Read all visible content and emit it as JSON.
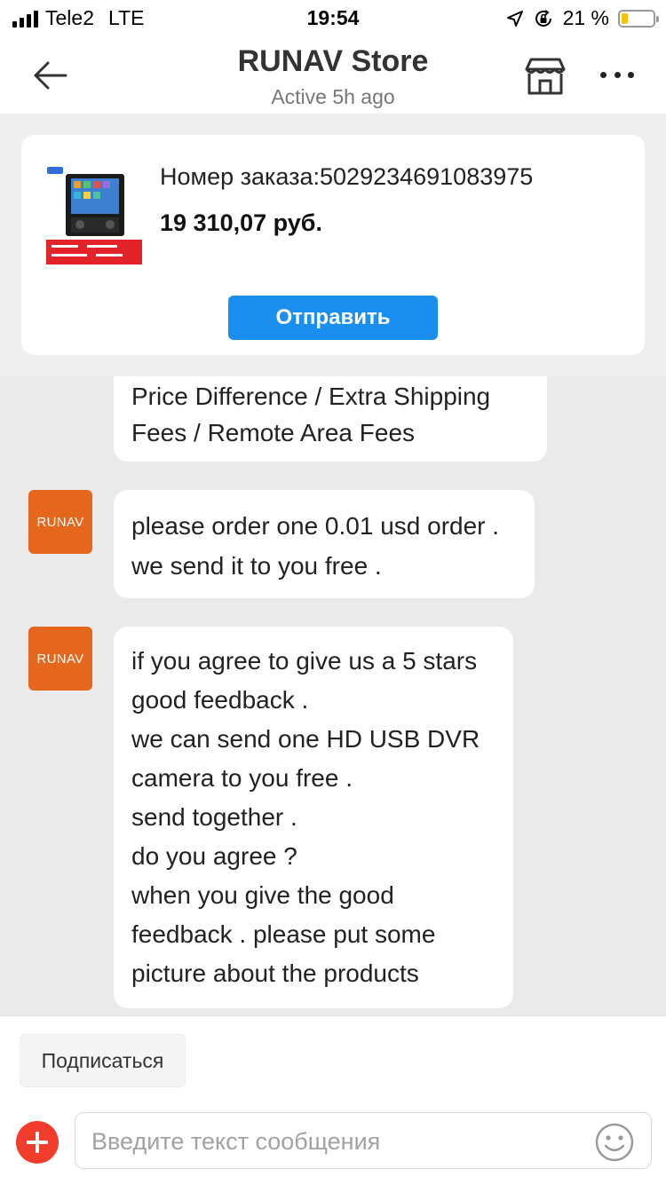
{
  "status_bar": {
    "carrier": "Tele2",
    "network": "LTE",
    "time": "19:54",
    "battery_percent": "21 %",
    "battery_level": 0.21,
    "icons": [
      "signal-icon",
      "location-icon",
      "orientation-lock-icon",
      "battery-icon"
    ]
  },
  "header": {
    "title": "RUNAV Store",
    "subtitle": "Active 5h ago",
    "icons": [
      "back-arrow-icon",
      "store-icon",
      "more-icon"
    ]
  },
  "order": {
    "number_label": "Номер заказа:5029234691083975",
    "price": "19 310,07 руб.",
    "send_label": "Отправить",
    "thumbnail": "product-thumbnail"
  },
  "messages": [
    {
      "sender": "",
      "lines": [
        "Price Difference / Extra Shipping",
        "Fees / Remote Area Fees"
      ]
    },
    {
      "sender": "RUNAV",
      "lines": [
        "please order one 0.01 usd order .",
        "we send it to you free ."
      ]
    },
    {
      "sender": "RUNAV",
      "lines": [
        "if you agree to give us a 5 stars",
        "good feedback .",
        "we can send one HD USB DVR",
        "camera to you free .",
        "send together .",
        "do you agree ?",
        "when you give the good",
        "feedback . please put some",
        "picture about the products"
      ]
    }
  ],
  "bottom_bar": {
    "subscribe_label": "Подписаться",
    "input_placeholder": "Введите текст сообщения",
    "icons": [
      "plus-icon",
      "emoji-icon"
    ]
  },
  "colors": {
    "accent_blue": "#1a8ff0",
    "avatar_orange": "#e4671d",
    "plus_red": "#f23d2c",
    "battery_yellow": "#f5c400",
    "chat_background": "#eaeaea"
  }
}
